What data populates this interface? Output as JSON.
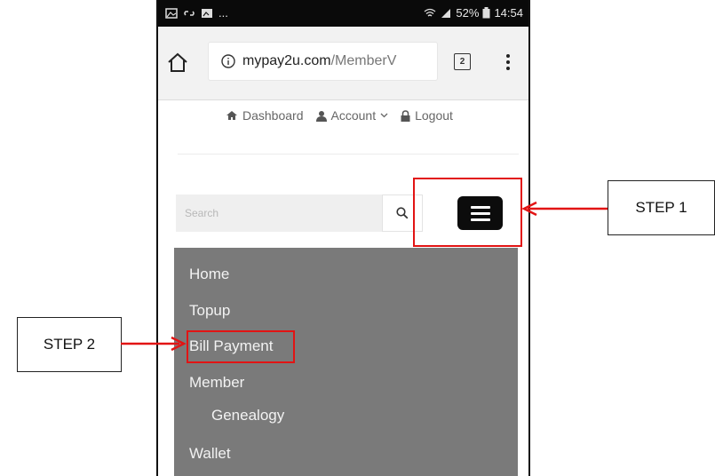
{
  "status_bar": {
    "ellipsis": "...",
    "battery_percent": "52%",
    "time": "14:54"
  },
  "browser": {
    "url_domain": "mypay2u.com",
    "url_path": "/MemberV",
    "tab_count": "2"
  },
  "top_nav": {
    "dashboard": "Dashboard",
    "account": "Account",
    "logout": "Logout"
  },
  "search": {
    "placeholder": "Search"
  },
  "menu": {
    "items": [
      "Home",
      "Topup",
      "Bill Payment",
      "Member",
      "Genealogy",
      "Wallet"
    ]
  },
  "callouts": {
    "step1": "STEP 1",
    "step2": "STEP 2"
  },
  "colors": {
    "highlight": "#e21414",
    "menu_bg": "#7a7a7a"
  }
}
